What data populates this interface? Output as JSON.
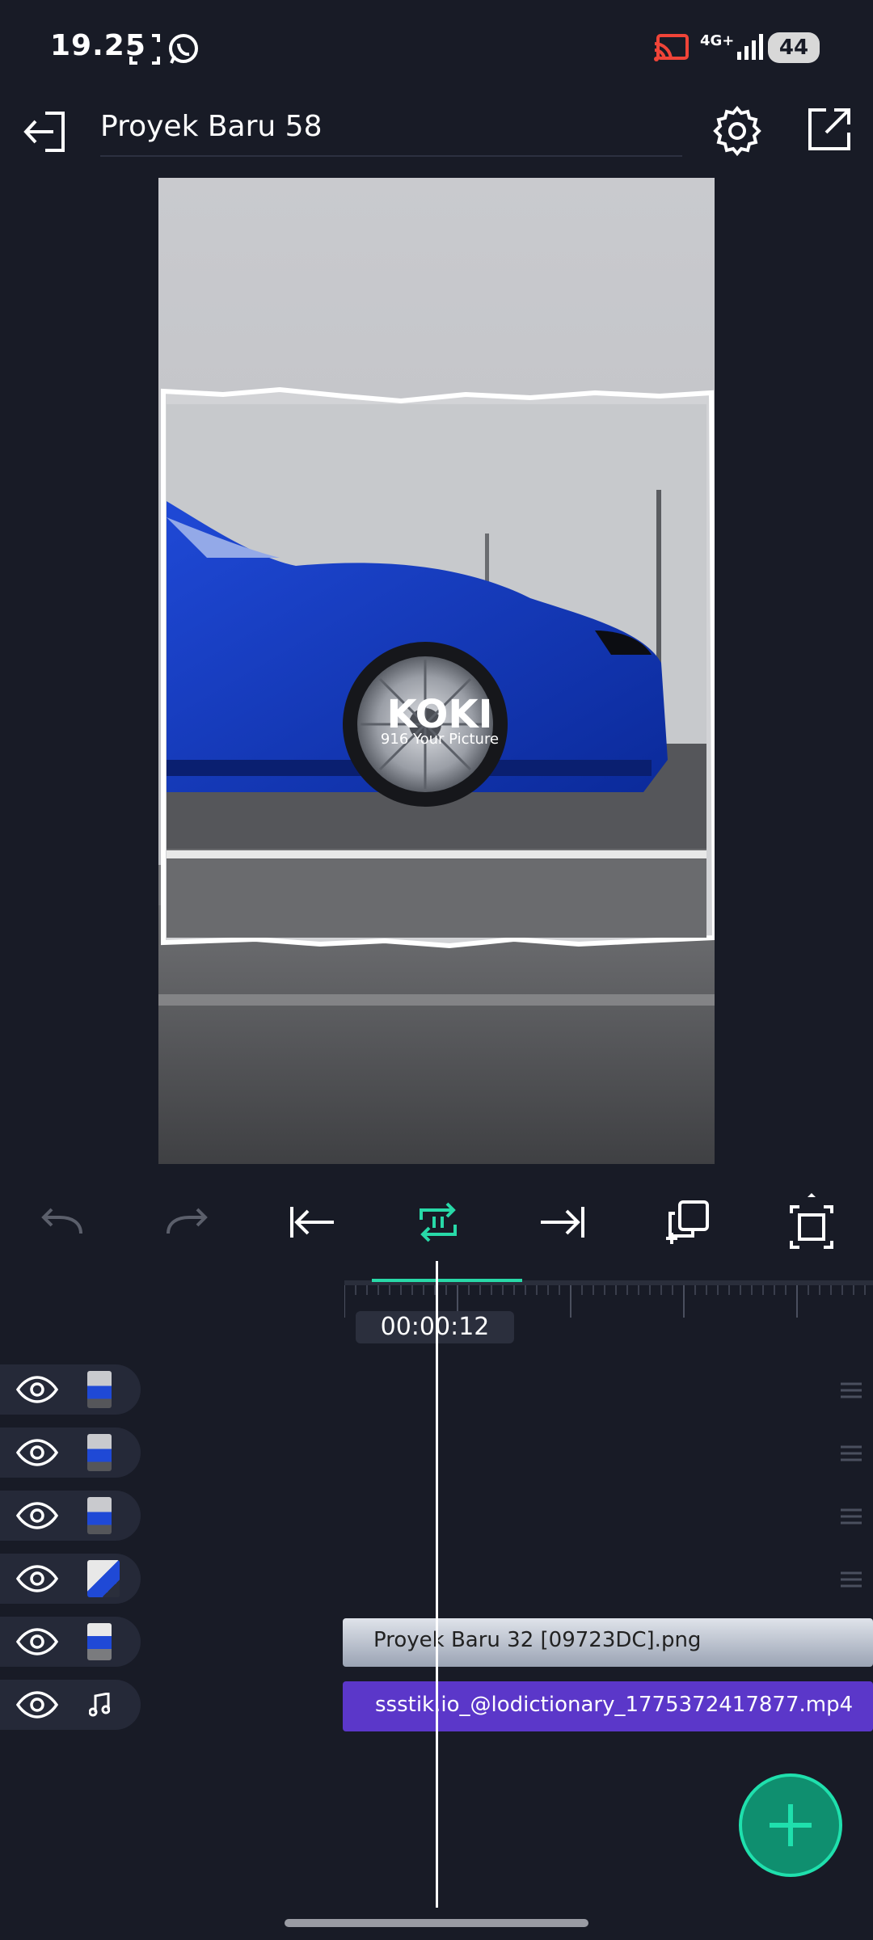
{
  "status_bar": {
    "time": "19.25",
    "network": "4G+",
    "battery": "44",
    "icons": [
      "screenshot-icon",
      "whatsapp-icon",
      "cast-icon",
      "signal-icon",
      "battery-icon"
    ]
  },
  "header": {
    "title": "Proyek Baru 58",
    "icons": [
      "exit-icon",
      "settings-icon",
      "share-icon"
    ]
  },
  "preview": {
    "sticker_title": "KOKI",
    "sticker_subtitle": "916 Your Picture"
  },
  "toolbar": {
    "icons": [
      "undo-icon",
      "redo-icon",
      "jump-to-start-icon",
      "loop-icon",
      "jump-to-end-icon",
      "copy-add-icon",
      "fullscreen-icon"
    ]
  },
  "timeline": {
    "timecode": "00:00:12",
    "tracks": [
      {
        "type": "image",
        "visible": true
      },
      {
        "type": "image",
        "visible": true
      },
      {
        "type": "image",
        "visible": true
      },
      {
        "type": "image",
        "visible": true
      },
      {
        "type": "image",
        "visible": true
      },
      {
        "type": "audio",
        "visible": true
      }
    ],
    "clips": {
      "image_clip": "Proyek Baru 32 [09723DC].png",
      "audio_clip": "ssstik.io_@lodictionary_1775372417877.mp4"
    }
  },
  "colors": {
    "background": "#181b26",
    "accent": "#1fe0ad",
    "audio_clip": "#5b37c9",
    "loop_active": "#28d9a8"
  }
}
